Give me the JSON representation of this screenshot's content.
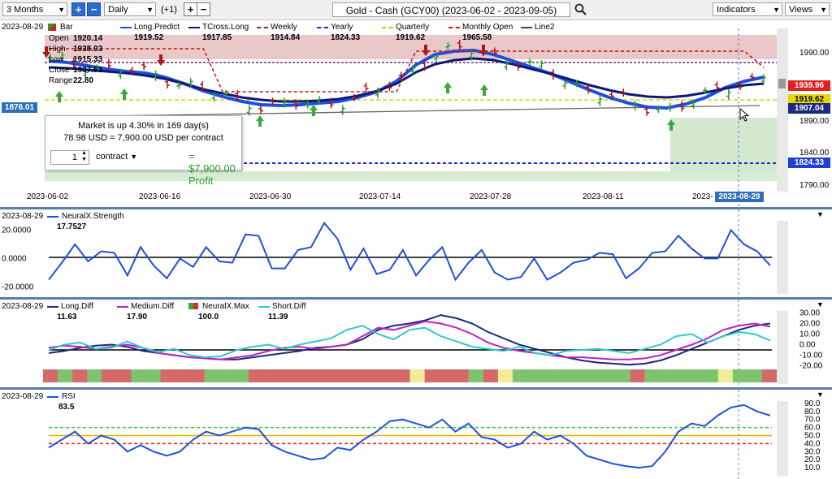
{
  "toolbar": {
    "range": "3 Months",
    "interval": "Daily",
    "offset": "(+1)",
    "title": "Gold - Cash (GCY00) (2023-06-02 - 2023-09-05)",
    "indicators": "Indicators",
    "views": "Views"
  },
  "price_pane": {
    "date": "2023-08-29",
    "bar_label": "Bar",
    "ohlc": [
      {
        "k": "Open",
        "v": "1920.14"
      },
      {
        "k": "High",
        "v": "1938.03"
      },
      {
        "k": "Low",
        "v": "1915.33"
      },
      {
        "k": "Close",
        "v": "1937.53"
      },
      {
        "k": "Range",
        "v": "22.80"
      }
    ],
    "legend": [
      {
        "name": "Long.Predict",
        "value": "1919.52",
        "color": "#1f4fe0"
      },
      {
        "name": "TCross.Long",
        "value": "1917.85",
        "color": "#0a1a7a"
      },
      {
        "name": "Weekly",
        "value": "1914.84",
        "color": "#7a2a6a"
      },
      {
        "name": "Yearly",
        "value": "1824.33",
        "color": "#1a2ad0"
      },
      {
        "name": "Quarterly",
        "value": "1919.62",
        "color": "#d4c400"
      },
      {
        "name": "Monthly Open",
        "value": "1965.58",
        "color": "#d01010"
      },
      {
        "name": "Line2",
        "value": "",
        "color": "#444444"
      }
    ],
    "y_ticks": [
      "1990.00",
      "1940.00",
      "1890.00",
      "1840.00",
      "1790.00"
    ],
    "x_ticks": [
      "2023-06-02",
      "2023-06-16",
      "2023-06-30",
      "2023-07-14",
      "2023-07-28",
      "2023-08-11",
      "2023-",
      "2023-08-29"
    ],
    "left_price_tag": "1876.01",
    "price_tags": [
      {
        "v": "1939.96",
        "bg": "#e02020"
      },
      {
        "v": "1919.62",
        "bg": "#e8d800"
      },
      {
        "v": "1907.04",
        "bg": "#1a2a80"
      },
      {
        "v": "1824.33",
        "bg": "#2040d0"
      }
    ],
    "popup": {
      "line1": "Market is up 4.30% in 169 day(s)",
      "line2": "78.98 USD = 7,900.00 USD per contract",
      "qty": "1",
      "unit": "contract",
      "profit": "= $7,900.00 Profit"
    }
  },
  "strength_pane": {
    "date": "2023-08-29",
    "name": "NeuralX.Strength",
    "value": "17.7527",
    "y_ticks": [
      "20.0000",
      "0.0000",
      "-20.0000"
    ]
  },
  "diff_pane": {
    "date": "2023-08-29",
    "legend": [
      {
        "name": "Long.Diff",
        "value": "11.63",
        "color": "#1a2a80"
      },
      {
        "name": "Medium.Diff",
        "value": "17.90",
        "color": "#c020c0"
      },
      {
        "name": "NeuralX.Max",
        "value": "100.0",
        "color": "#d03030"
      },
      {
        "name": "Short.Diff",
        "value": "11.39",
        "color": "#30c8d0"
      }
    ],
    "y_ticks": [
      "30.00",
      "20.00",
      "10.00",
      "0.00",
      "-10.00",
      "-20.00"
    ]
  },
  "rsi_pane": {
    "date": "2023-08-29",
    "name": "RSI",
    "value": "83.5",
    "y_ticks": [
      "90.0",
      "80.0",
      "70.0",
      "60.0",
      "50.0",
      "40.0",
      "30.0",
      "20.0",
      "10.0"
    ]
  },
  "chart_data": [
    {
      "type": "line",
      "title": "Gold - Cash (GCY00)",
      "ylim": [
        1790,
        2000
      ],
      "series": [
        {
          "name": "Long.Predict",
          "values": [
            1950,
            1948,
            1944,
            1940,
            1937,
            1935,
            1930,
            1922,
            1913,
            1906,
            1900,
            1896,
            1895,
            1896,
            1898,
            1900,
            1905,
            1912,
            1925,
            1945,
            1958,
            1962,
            1963,
            1958,
            1950,
            1942,
            1934,
            1924,
            1914,
            1905,
            1898,
            1893,
            1892,
            1897,
            1905,
            1917,
            1925,
            1930
          ]
        },
        {
          "name": "TCross.Long",
          "values": [
            1942,
            1941,
            1939,
            1937,
            1935,
            1932,
            1928,
            1922,
            1915,
            1910,
            1905,
            1902,
            1900,
            1900,
            1901,
            1903,
            1907,
            1913,
            1922,
            1936,
            1946,
            1951,
            1953,
            1951,
            1946,
            1940,
            1934,
            1927,
            1920,
            1914,
            1909,
            1906,
            1905,
            1907,
            1911,
            1916,
            1920,
            1922
          ]
        },
        {
          "name": "Monthly Open",
          "values": [
            1965,
            1965,
            1965,
            1965,
            1965,
            1965,
            1965,
            1965,
            1965,
            1912,
            1912,
            1912,
            1912,
            1912,
            1912,
            1912,
            1912,
            1912,
            1912,
            1962,
            1962,
            1962,
            1962,
            1962,
            1962,
            1962,
            1962,
            1962,
            1962,
            1962,
            1962,
            1962,
            1962,
            1962,
            1962,
            1962,
            1962,
            1942
          ]
        },
        {
          "name": "Quarterly",
          "values": [
            1920,
            1920,
            1920,
            1920,
            1920,
            1920,
            1920,
            1920,
            1920,
            1920,
            1920,
            1920,
            1920,
            1920,
            1920,
            1920,
            1920,
            1920,
            1920,
            1920,
            1920,
            1920,
            1920,
            1920,
            1920,
            1920,
            1920,
            1920,
            1920,
            1920,
            1920,
            1920,
            1920,
            1920,
            1920,
            1920,
            1920,
            1920
          ]
        }
      ]
    },
    {
      "type": "line",
      "title": "NeuralX.Strength",
      "ylim": [
        -25,
        30
      ],
      "series": [
        {
          "name": "NeuralX.Strength",
          "values": [
            -15,
            -3,
            10,
            -2,
            5,
            4,
            -12,
            8,
            -5,
            -14,
            0,
            -6,
            8,
            -2,
            -3,
            17,
            16,
            -7,
            -7,
            6,
            8,
            25,
            14,
            -8,
            7,
            -11,
            -8,
            6,
            -12,
            -1,
            8,
            -15,
            -3,
            6,
            -10,
            -15,
            -13,
            0,
            -15,
            -10,
            -3,
            -1,
            4,
            3,
            -14,
            -7,
            4,
            5,
            16,
            7,
            0,
            0,
            20,
            10,
            5,
            -5
          ]
        }
      ]
    },
    {
      "type": "line",
      "title": "Diff",
      "ylim": [
        -25,
        35
      ],
      "series": [
        {
          "name": "Long.Diff",
          "values": [
            -8,
            -6,
            -3,
            -1,
            0,
            -2,
            -6,
            -8,
            -10,
            -12,
            -13,
            -14,
            -14,
            -12,
            -10,
            -8,
            -6,
            -3,
            -2,
            0,
            5,
            14,
            18,
            20,
            23,
            28,
            25,
            20,
            12,
            6,
            0,
            -4,
            -8,
            -12,
            -15,
            -17,
            -18,
            -19,
            -18,
            -15,
            -10,
            -4,
            2,
            8,
            14,
            18,
            20
          ]
        },
        {
          "name": "Medium.Diff",
          "values": [
            -3,
            -1,
            -2,
            -4,
            -2,
            0,
            -3,
            -8,
            -10,
            -12,
            -13,
            -14,
            -12,
            -10,
            -6,
            -3,
            -2,
            -4,
            -2,
            0,
            8,
            16,
            14,
            18,
            22,
            20,
            16,
            10,
            2,
            -3,
            -6,
            -8,
            -10,
            -12,
            -12,
            -13,
            -14,
            -14,
            -13,
            -10,
            -5,
            0,
            6,
            14,
            18,
            20,
            17
          ]
        },
        {
          "name": "Short.Diff",
          "values": [
            -5,
            0,
            2,
            -4,
            -3,
            3,
            -3,
            -7,
            -4,
            -10,
            -12,
            -11,
            -5,
            -2,
            0,
            -4,
            0,
            3,
            6,
            14,
            18,
            10,
            5,
            14,
            16,
            8,
            3,
            -2,
            -4,
            -6,
            -2,
            -8,
            -10,
            -6,
            -5,
            -4,
            -6,
            -8,
            -4,
            0,
            8,
            10,
            2,
            8,
            12,
            10,
            4
          ]
        }
      ]
    },
    {
      "type": "line",
      "title": "RSI",
      "ylim": [
        0,
        95
      ],
      "series": [
        {
          "name": "RSI",
          "values": [
            35,
            45,
            55,
            40,
            50,
            45,
            30,
            38,
            30,
            25,
            30,
            45,
            55,
            50,
            55,
            60,
            58,
            38,
            30,
            25,
            20,
            22,
            35,
            32,
            45,
            55,
            68,
            70,
            65,
            60,
            70,
            55,
            65,
            48,
            45,
            35,
            40,
            55,
            45,
            50,
            40,
            25,
            20,
            15,
            12,
            10,
            12,
            30,
            55,
            65,
            62,
            75,
            85,
            88,
            80,
            75
          ]
        }
      ]
    }
  ]
}
